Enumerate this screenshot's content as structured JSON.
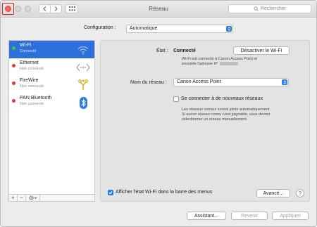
{
  "window": {
    "title": "Réseau",
    "search_placeholder": "Rechercher"
  },
  "configuration": {
    "label": "Configuration :",
    "value": "Automatique"
  },
  "sidebar": {
    "items": [
      {
        "name": "Wi-Fi",
        "status": "Connecté",
        "dot_color": "#34c759",
        "selected": true,
        "icon": "wifi-icon"
      },
      {
        "name": "Ethernet",
        "status": "Non connecté",
        "dot_color": "#e0393e",
        "selected": false,
        "icon": "ethernet-icon"
      },
      {
        "name": "FireWire",
        "status": "Non connecté",
        "dot_color": "#e0393e",
        "selected": false,
        "icon": "firewire-icon"
      },
      {
        "name": "PAN Bluetooth",
        "status": "Non connecté",
        "dot_color": "#e0393e",
        "selected": false,
        "icon": "bluetooth-icon"
      }
    ],
    "tools": {
      "add": "+",
      "remove": "−"
    }
  },
  "detail": {
    "state_label": "État :",
    "state_value": "Connecté",
    "disable_button": "Désactiver le Wi-Fi",
    "state_desc_line1": "Wi-Fi est connecté à Canon Access Point et",
    "state_desc_line2": "possède l'adresse IP",
    "network_label": "Nom du réseau :",
    "network_value": "Canon Access Point",
    "join_new_label": "Se connecter à de nouveaux réseaux",
    "join_desc_line1": "Les réseaux connus seront joints automatiquement.",
    "join_desc_line2": "Si aucun réseau connu n'est joignable, vous devrez",
    "join_desc_line3": "sélectionner un réseau manuellement.",
    "show_status_label": "Afficher l'état Wi-Fi dans la barre des menus",
    "advanced_button": "Avancé...",
    "help": "?"
  },
  "footer": {
    "assistant": "Assistant...",
    "revert": "Revenir",
    "apply": "Appliquer"
  },
  "colors": {
    "accent": "#2b7de9",
    "selection": "#2d6fdb",
    "close": "#fc605b"
  }
}
